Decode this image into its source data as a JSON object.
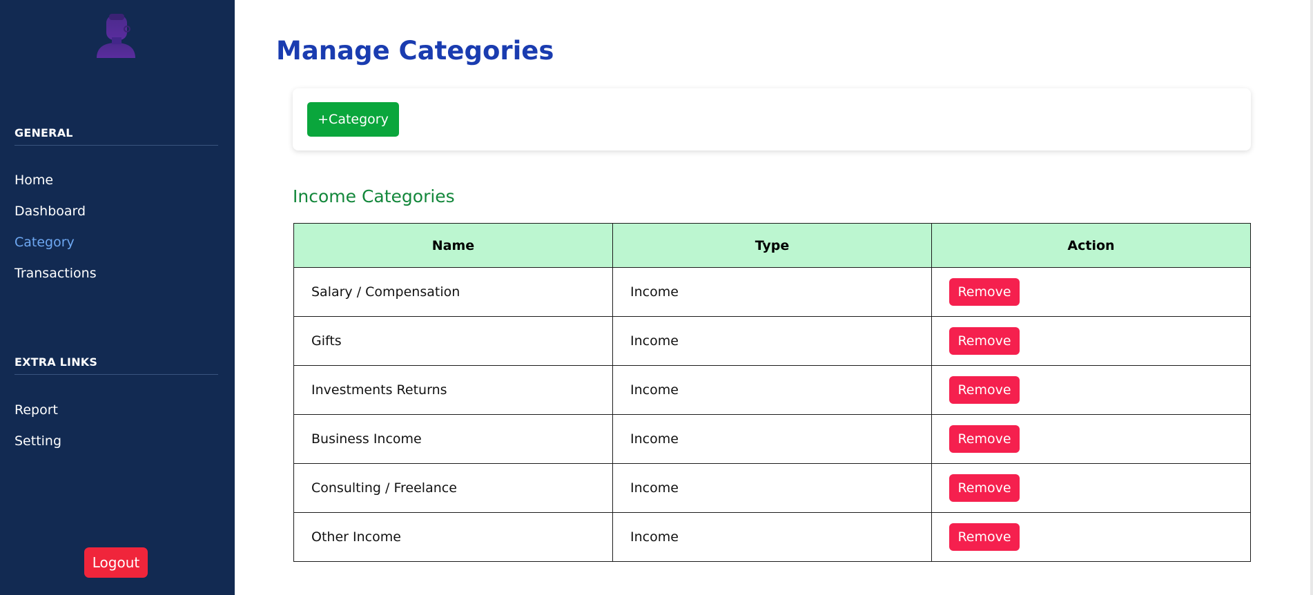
{
  "sidebar": {
    "general_heading": "GENERAL",
    "general_items": [
      {
        "label": "Home",
        "active": false
      },
      {
        "label": "Dashboard",
        "active": false
      },
      {
        "label": "Category",
        "active": true
      },
      {
        "label": "Transactions",
        "active": false
      }
    ],
    "extra_heading": "EXTRA LINKS",
    "extra_items": [
      {
        "label": "Report"
      },
      {
        "label": "Setting"
      }
    ],
    "logout_label": "Logout",
    "avatar_icon": "user-avatar-icon"
  },
  "main": {
    "title": "Manage Categories",
    "add_button_label": "+Category",
    "section_title": "Income Categories",
    "table": {
      "columns": [
        "Name",
        "Type",
        "Action"
      ],
      "rows": [
        {
          "name": "Salary / Compensation",
          "type": "Income",
          "action": "Remove"
        },
        {
          "name": "Gifts",
          "type": "Income",
          "action": "Remove"
        },
        {
          "name": "Investments Returns",
          "type": "Income",
          "action": "Remove"
        },
        {
          "name": "Business Income",
          "type": "Income",
          "action": "Remove"
        },
        {
          "name": "Consulting / Freelance",
          "type": "Income",
          "action": "Remove"
        },
        {
          "name": "Other Income",
          "type": "Income",
          "action": "Remove"
        }
      ]
    }
  },
  "colors": {
    "sidebar_bg": "#122a52",
    "active_link": "#6ea8f2",
    "title_blue": "#1a3cb0",
    "add_green": "#0aa63c",
    "section_green": "#13873b",
    "header_mint": "#bcf6d0",
    "remove_red": "#f5204e",
    "logout_red": "#f0253b"
  }
}
